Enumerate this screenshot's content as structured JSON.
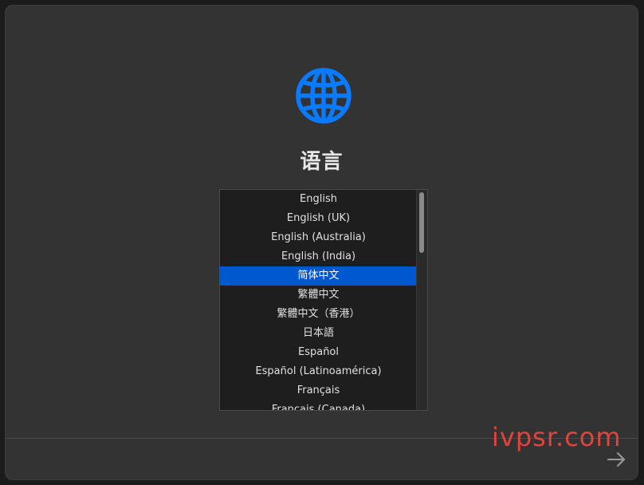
{
  "title": "语言",
  "languages": [
    "English",
    "English (UK)",
    "English (Australia)",
    "English (India)",
    "简体中文",
    "繁體中文",
    "繁體中文（香港）",
    "日本語",
    "Español",
    "Español (Latinoamérica)",
    "Français",
    "Français (Canada)"
  ],
  "selected_language": "简体中文",
  "watermark": "ivpsr.com",
  "icons": {
    "header": "globe-icon",
    "next": "arrow-right-icon"
  },
  "colors": {
    "accent": "#0a7aff",
    "selection": "#0058d0",
    "watermark": "#e0443a"
  }
}
